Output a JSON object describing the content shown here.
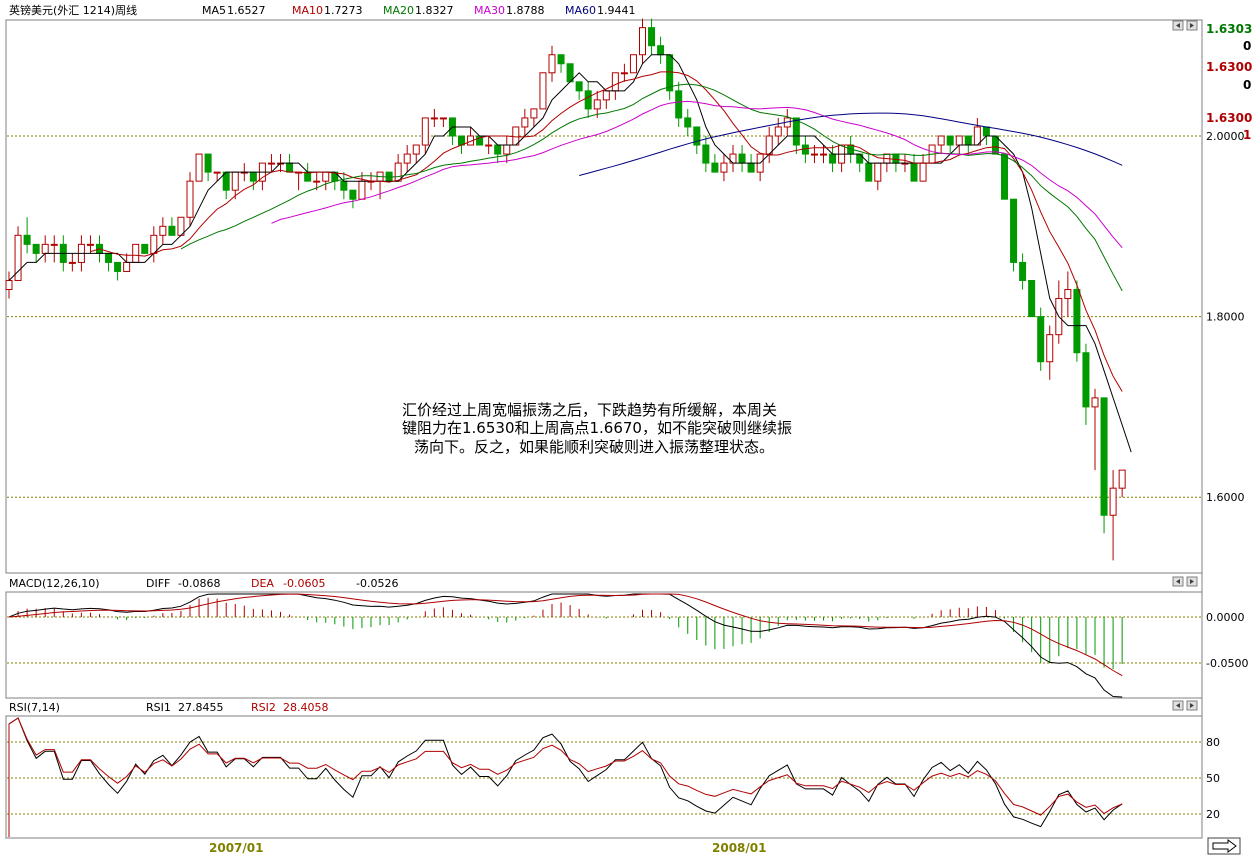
{
  "header": {
    "title": "英镑美元(外汇 1214)周线",
    "ma": [
      {
        "label": "MA5",
        "value": "1.6527",
        "color": "#000000"
      },
      {
        "label": "MA10",
        "value": "1.7273",
        "color": "#b00000"
      },
      {
        "label": "MA20",
        "value": "1.8327",
        "color": "#007700"
      },
      {
        "label": "MA30",
        "value": "1.8788",
        "color": "#cc00cc"
      },
      {
        "label": "MA60",
        "value": "1.9441",
        "color": "#000080"
      }
    ]
  },
  "price_axis": {
    "top_labels": [
      {
        "text": "1.6303",
        "color": "#007700"
      },
      {
        "text": "0",
        "color": "#000000"
      },
      {
        "text": "1.6300",
        "color": "#b00000"
      },
      {
        "text": "0",
        "color": "#000000"
      },
      {
        "text": "1.6300",
        "color": "#b00000"
      },
      {
        "text": "1",
        "color": "#b00000"
      }
    ],
    "levels": [
      "2.0000",
      "1.8000",
      "1.6000"
    ]
  },
  "annotation": [
    "汇价经过上周宽幅振荡之后，下跌趋势有所缓解，本周关",
    "键阻力在1.6530和上周高点1.6670，如不能突破则继续振",
    "荡向下。反之，如果能顺利突破则进入振荡整理状态。"
  ],
  "macd": {
    "label": "MACD(12,26,10)",
    "diff_label": "DIFF",
    "diff_value": "-0.0868",
    "dea_label": "DEA",
    "dea_value": "-0.0605",
    "macd_value": "-0.0526",
    "levels": [
      "0.0000",
      "-0.0500"
    ]
  },
  "rsi": {
    "label": "RSI(7,14)",
    "rsi1_label": "RSI1",
    "rsi1_value": "27.8455",
    "rsi2_label": "RSI2",
    "rsi2_value": "28.4058",
    "levels": [
      "80",
      "50",
      "20"
    ]
  },
  "time_axis": {
    "labels": [
      "2007/01",
      "2008/01"
    ]
  },
  "colors": {
    "up": "#b00000",
    "down": "#009900",
    "grid": "#808000"
  },
  "chart_data": {
    "type": "candlestick",
    "ylim": [
      1.53,
      2.1
    ],
    "candles": [
      [
        1.83,
        1.85,
        1.82,
        1.84
      ],
      [
        1.84,
        1.9,
        1.84,
        1.89
      ],
      [
        1.89,
        1.91,
        1.87,
        1.88
      ],
      [
        1.88,
        1.88,
        1.86,
        1.87
      ],
      [
        1.87,
        1.89,
        1.86,
        1.88
      ],
      [
        1.88,
        1.89,
        1.86,
        1.88
      ],
      [
        1.88,
        1.89,
        1.85,
        1.86
      ],
      [
        1.86,
        1.87,
        1.85,
        1.86
      ],
      [
        1.86,
        1.89,
        1.85,
        1.88
      ],
      [
        1.88,
        1.89,
        1.87,
        1.88
      ],
      [
        1.88,
        1.89,
        1.86,
        1.87
      ],
      [
        1.87,
        1.87,
        1.85,
        1.86
      ],
      [
        1.86,
        1.86,
        1.84,
        1.85
      ],
      [
        1.85,
        1.87,
        1.85,
        1.86
      ],
      [
        1.86,
        1.88,
        1.86,
        1.88
      ],
      [
        1.88,
        1.88,
        1.87,
        1.87
      ],
      [
        1.87,
        1.9,
        1.86,
        1.89
      ],
      [
        1.89,
        1.91,
        1.88,
        1.9
      ],
      [
        1.9,
        1.91,
        1.89,
        1.89
      ],
      [
        1.89,
        1.91,
        1.89,
        1.91
      ],
      [
        1.91,
        1.96,
        1.9,
        1.95
      ],
      [
        1.95,
        1.98,
        1.95,
        1.98
      ],
      [
        1.98,
        1.98,
        1.95,
        1.96
      ],
      [
        1.96,
        1.96,
        1.95,
        1.96
      ],
      [
        1.96,
        1.96,
        1.93,
        1.94
      ],
      [
        1.94,
        1.96,
        1.93,
        1.96
      ],
      [
        1.96,
        1.97,
        1.95,
        1.96
      ],
      [
        1.96,
        1.96,
        1.94,
        1.95
      ],
      [
        1.95,
        1.97,
        1.94,
        1.97
      ],
      [
        1.97,
        1.98,
        1.96,
        1.97
      ],
      [
        1.97,
        1.98,
        1.96,
        1.97
      ],
      [
        1.97,
        1.98,
        1.96,
        1.96
      ],
      [
        1.96,
        1.96,
        1.94,
        1.96
      ],
      [
        1.96,
        1.97,
        1.95,
        1.95
      ],
      [
        1.95,
        1.96,
        1.94,
        1.95
      ],
      [
        1.95,
        1.96,
        1.94,
        1.96
      ],
      [
        1.96,
        1.96,
        1.94,
        1.95
      ],
      [
        1.95,
        1.96,
        1.93,
        1.94
      ],
      [
        1.94,
        1.94,
        1.92,
        1.93
      ],
      [
        1.93,
        1.96,
        1.93,
        1.95
      ],
      [
        1.95,
        1.96,
        1.94,
        1.95
      ],
      [
        1.95,
        1.96,
        1.93,
        1.96
      ],
      [
        1.96,
        1.96,
        1.95,
        1.95
      ],
      [
        1.95,
        1.98,
        1.95,
        1.97
      ],
      [
        1.97,
        1.99,
        1.96,
        1.98
      ],
      [
        1.98,
        1.99,
        1.97,
        1.99
      ],
      [
        1.99,
        2.02,
        1.98,
        2.02
      ],
      [
        2.02,
        2.03,
        2.01,
        2.02
      ],
      [
        2.02,
        2.02,
        2.01,
        2.02
      ],
      [
        2.02,
        2.02,
        1.99,
        2.0
      ],
      [
        2.0,
        2.0,
        1.98,
        1.99
      ],
      [
        1.99,
        2.01,
        1.99,
        2.0
      ],
      [
        2.0,
        2.0,
        1.99,
        1.99
      ],
      [
        1.99,
        2.0,
        1.98,
        1.99
      ],
      [
        1.99,
        1.99,
        1.97,
        1.98
      ],
      [
        1.98,
        2.0,
        1.97,
        1.99
      ],
      [
        1.99,
        2.01,
        1.99,
        2.01
      ],
      [
        2.01,
        2.03,
        2.0,
        2.02
      ],
      [
        2.02,
        2.03,
        2.01,
        2.03
      ],
      [
        2.03,
        2.07,
        2.03,
        2.07
      ],
      [
        2.07,
        2.1,
        2.06,
        2.09
      ],
      [
        2.09,
        2.09,
        2.07,
        2.08
      ],
      [
        2.08,
        2.08,
        2.06,
        2.06
      ],
      [
        2.06,
        2.06,
        2.04,
        2.05
      ],
      [
        2.05,
        2.06,
        2.02,
        2.03
      ],
      [
        2.03,
        2.05,
        2.02,
        2.04
      ],
      [
        2.04,
        2.05,
        2.03,
        2.05
      ],
      [
        2.05,
        2.07,
        2.04,
        2.07
      ],
      [
        2.07,
        2.08,
        2.06,
        2.07
      ],
      [
        2.07,
        2.09,
        2.07,
        2.09
      ],
      [
        2.09,
        2.13,
        2.08,
        2.12
      ],
      [
        2.12,
        2.13,
        2.09,
        2.1
      ],
      [
        2.1,
        2.11,
        2.08,
        2.09
      ],
      [
        2.09,
        2.09,
        2.04,
        2.05
      ],
      [
        2.05,
        2.06,
        2.01,
        2.02
      ],
      [
        2.02,
        2.03,
        2.0,
        2.01
      ],
      [
        2.01,
        2.01,
        1.98,
        1.99
      ],
      [
        1.99,
        2.0,
        1.96,
        1.97
      ],
      [
        1.97,
        1.98,
        1.96,
        1.96
      ],
      [
        1.96,
        1.98,
        1.95,
        1.97
      ],
      [
        1.97,
        1.99,
        1.96,
        1.98
      ],
      [
        1.98,
        1.99,
        1.96,
        1.97
      ],
      [
        1.97,
        1.98,
        1.96,
        1.96
      ],
      [
        1.96,
        1.98,
        1.95,
        1.98
      ],
      [
        1.98,
        2.01,
        1.97,
        2.0
      ],
      [
        2.0,
        2.02,
        1.99,
        2.01
      ],
      [
        2.01,
        2.03,
        2.0,
        2.02
      ],
      [
        2.02,
        2.02,
        1.98,
        1.99
      ],
      [
        1.99,
        2.0,
        1.97,
        1.98
      ],
      [
        1.98,
        1.99,
        1.97,
        1.98
      ],
      [
        1.98,
        1.99,
        1.97,
        1.98
      ],
      [
        1.98,
        1.99,
        1.96,
        1.97
      ],
      [
        1.97,
        1.99,
        1.96,
        1.99
      ],
      [
        1.99,
        2.0,
        1.97,
        1.98
      ],
      [
        1.98,
        1.98,
        1.96,
        1.97
      ],
      [
        1.97,
        1.98,
        1.95,
        1.95
      ],
      [
        1.95,
        1.97,
        1.94,
        1.97
      ],
      [
        1.97,
        1.98,
        1.96,
        1.98
      ],
      [
        1.98,
        1.98,
        1.96,
        1.97
      ],
      [
        1.97,
        1.98,
        1.96,
        1.97
      ],
      [
        1.97,
        1.98,
        1.95,
        1.95
      ],
      [
        1.95,
        1.98,
        1.95,
        1.97
      ],
      [
        1.97,
        1.99,
        1.97,
        1.99
      ],
      [
        1.99,
        2.0,
        1.98,
        2.0
      ],
      [
        2.0,
        2.0,
        1.98,
        1.99
      ],
      [
        1.99,
        2.0,
        1.98,
        2.0
      ],
      [
        2.0,
        2.0,
        1.98,
        1.99
      ],
      [
        1.99,
        2.02,
        1.99,
        2.01
      ],
      [
        2.01,
        2.01,
        1.99,
        2.0
      ],
      [
        2.0,
        2.0,
        1.98,
        1.98
      ],
      [
        1.98,
        1.98,
        1.93,
        1.93
      ],
      [
        1.93,
        1.93,
        1.85,
        1.86
      ],
      [
        1.86,
        1.87,
        1.83,
        1.84
      ],
      [
        1.84,
        1.84,
        1.8,
        1.8
      ],
      [
        1.8,
        1.81,
        1.74,
        1.75
      ],
      [
        1.75,
        1.79,
        1.73,
        1.78
      ],
      [
        1.78,
        1.84,
        1.77,
        1.82
      ],
      [
        1.82,
        1.85,
        1.8,
        1.83
      ],
      [
        1.83,
        1.84,
        1.75,
        1.76
      ],
      [
        1.76,
        1.77,
        1.68,
        1.7
      ],
      [
        1.7,
        1.72,
        1.63,
        1.71
      ],
      [
        1.71,
        1.71,
        1.56,
        1.58
      ],
      [
        1.58,
        1.63,
        1.53,
        1.61
      ],
      [
        1.61,
        1.63,
        1.6,
        1.63
      ]
    ],
    "ma5": [
      1.84,
      1.85,
      1.86,
      1.86,
      1.87,
      1.87,
      1.87,
      1.87,
      1.87,
      1.87,
      1.87,
      1.87,
      1.87,
      1.86,
      1.86,
      1.86,
      1.87,
      1.88,
      1.88,
      1.89,
      1.9,
      1.92,
      1.94,
      1.95,
      1.96,
      1.96,
      1.96,
      1.96,
      1.96,
      1.96,
      1.97,
      1.97,
      1.97,
      1.96,
      1.96,
      1.96,
      1.96,
      1.95,
      1.95,
      1.95,
      1.95,
      1.95,
      1.95,
      1.95,
      1.96,
      1.97,
      1.98,
      2.0,
      2.0,
      2.01,
      2.01,
      2.01,
      2.0,
      2.0,
      1.99,
      1.99,
      1.99,
      2.0,
      2.01,
      2.02,
      2.04,
      2.05,
      2.06,
      2.07,
      2.06,
      2.06,
      2.05,
      2.05,
      2.05,
      2.06,
      2.08,
      2.09,
      2.09,
      2.09,
      2.08,
      2.06,
      2.04,
      2.01,
      1.99,
      1.98,
      1.97,
      1.97,
      1.97,
      1.97,
      1.98,
      1.99,
      2.0,
      2.0,
      2.0,
      2.0,
      1.99,
      1.98,
      1.98,
      1.98,
      1.98,
      1.97,
      1.97,
      1.97,
      1.97,
      1.97,
      1.97,
      1.97,
      1.97,
      1.97,
      1.98,
      1.99,
      1.99,
      1.99,
      2.0,
      2.0,
      1.99,
      1.98,
      1.96,
      1.92,
      1.87,
      1.82,
      1.8,
      1.79,
      1.79,
      1.79,
      1.77,
      1.74,
      1.71,
      1.68,
      1.65
    ]
  }
}
